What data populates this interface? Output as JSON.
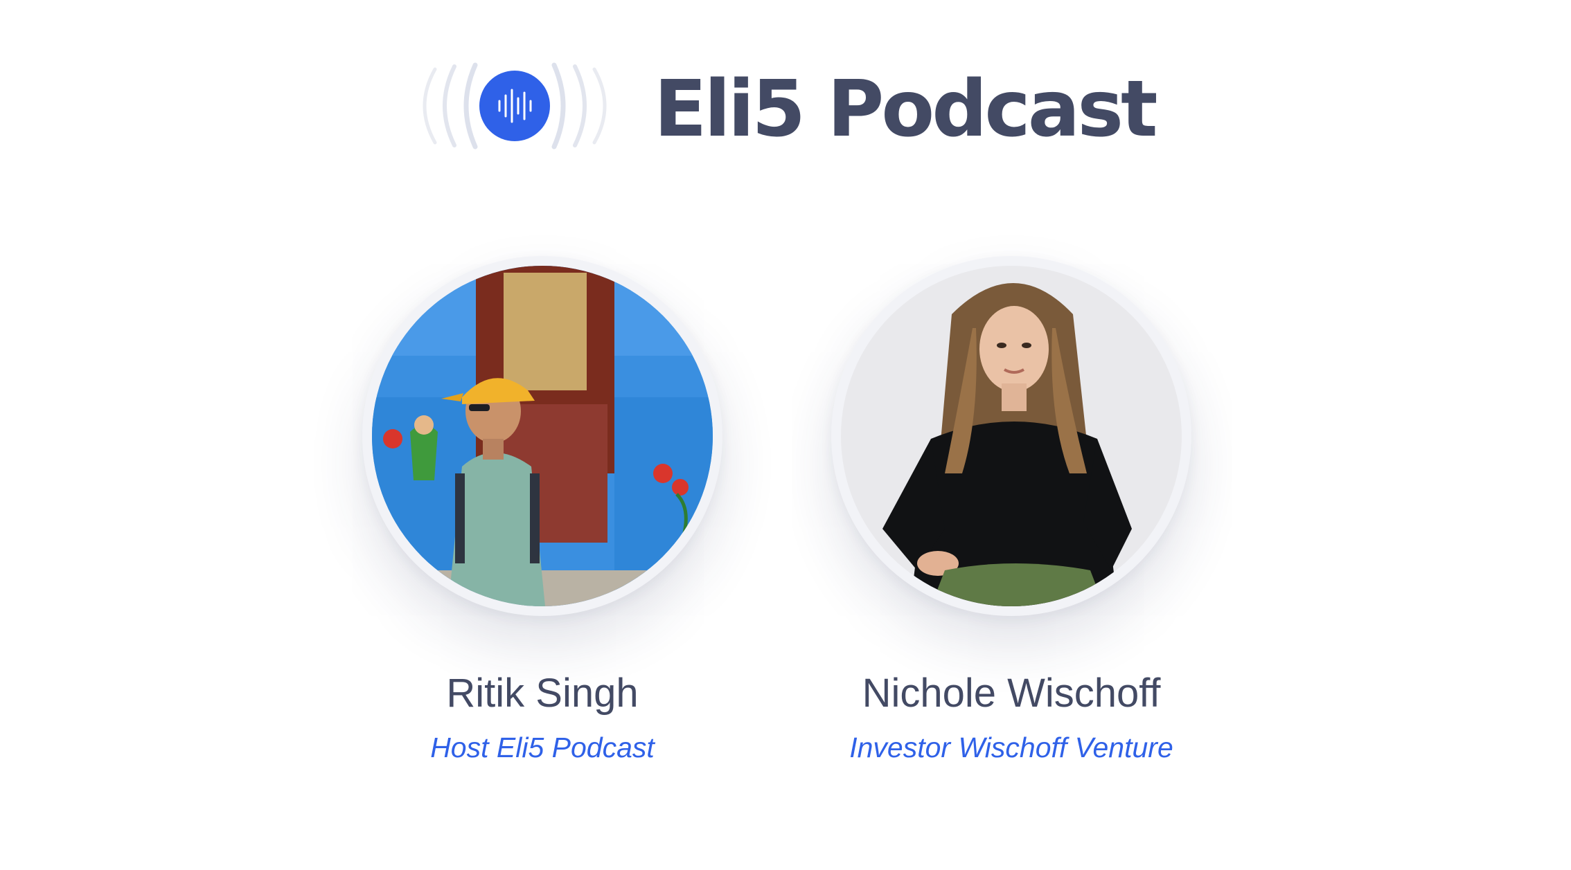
{
  "header": {
    "logo_icon": "podcast-soundwave-icon",
    "title": "Eli5 Podcast"
  },
  "colors": {
    "accent": "#2f61e8",
    "title": "#434a64"
  },
  "people": [
    {
      "name": "Ritik Singh",
      "role": "Host Eli5 Podcast",
      "photo": "host-photo"
    },
    {
      "name": "Nichole Wischoff",
      "role": "Investor Wischoff Venture",
      "photo": "guest-photo"
    }
  ]
}
